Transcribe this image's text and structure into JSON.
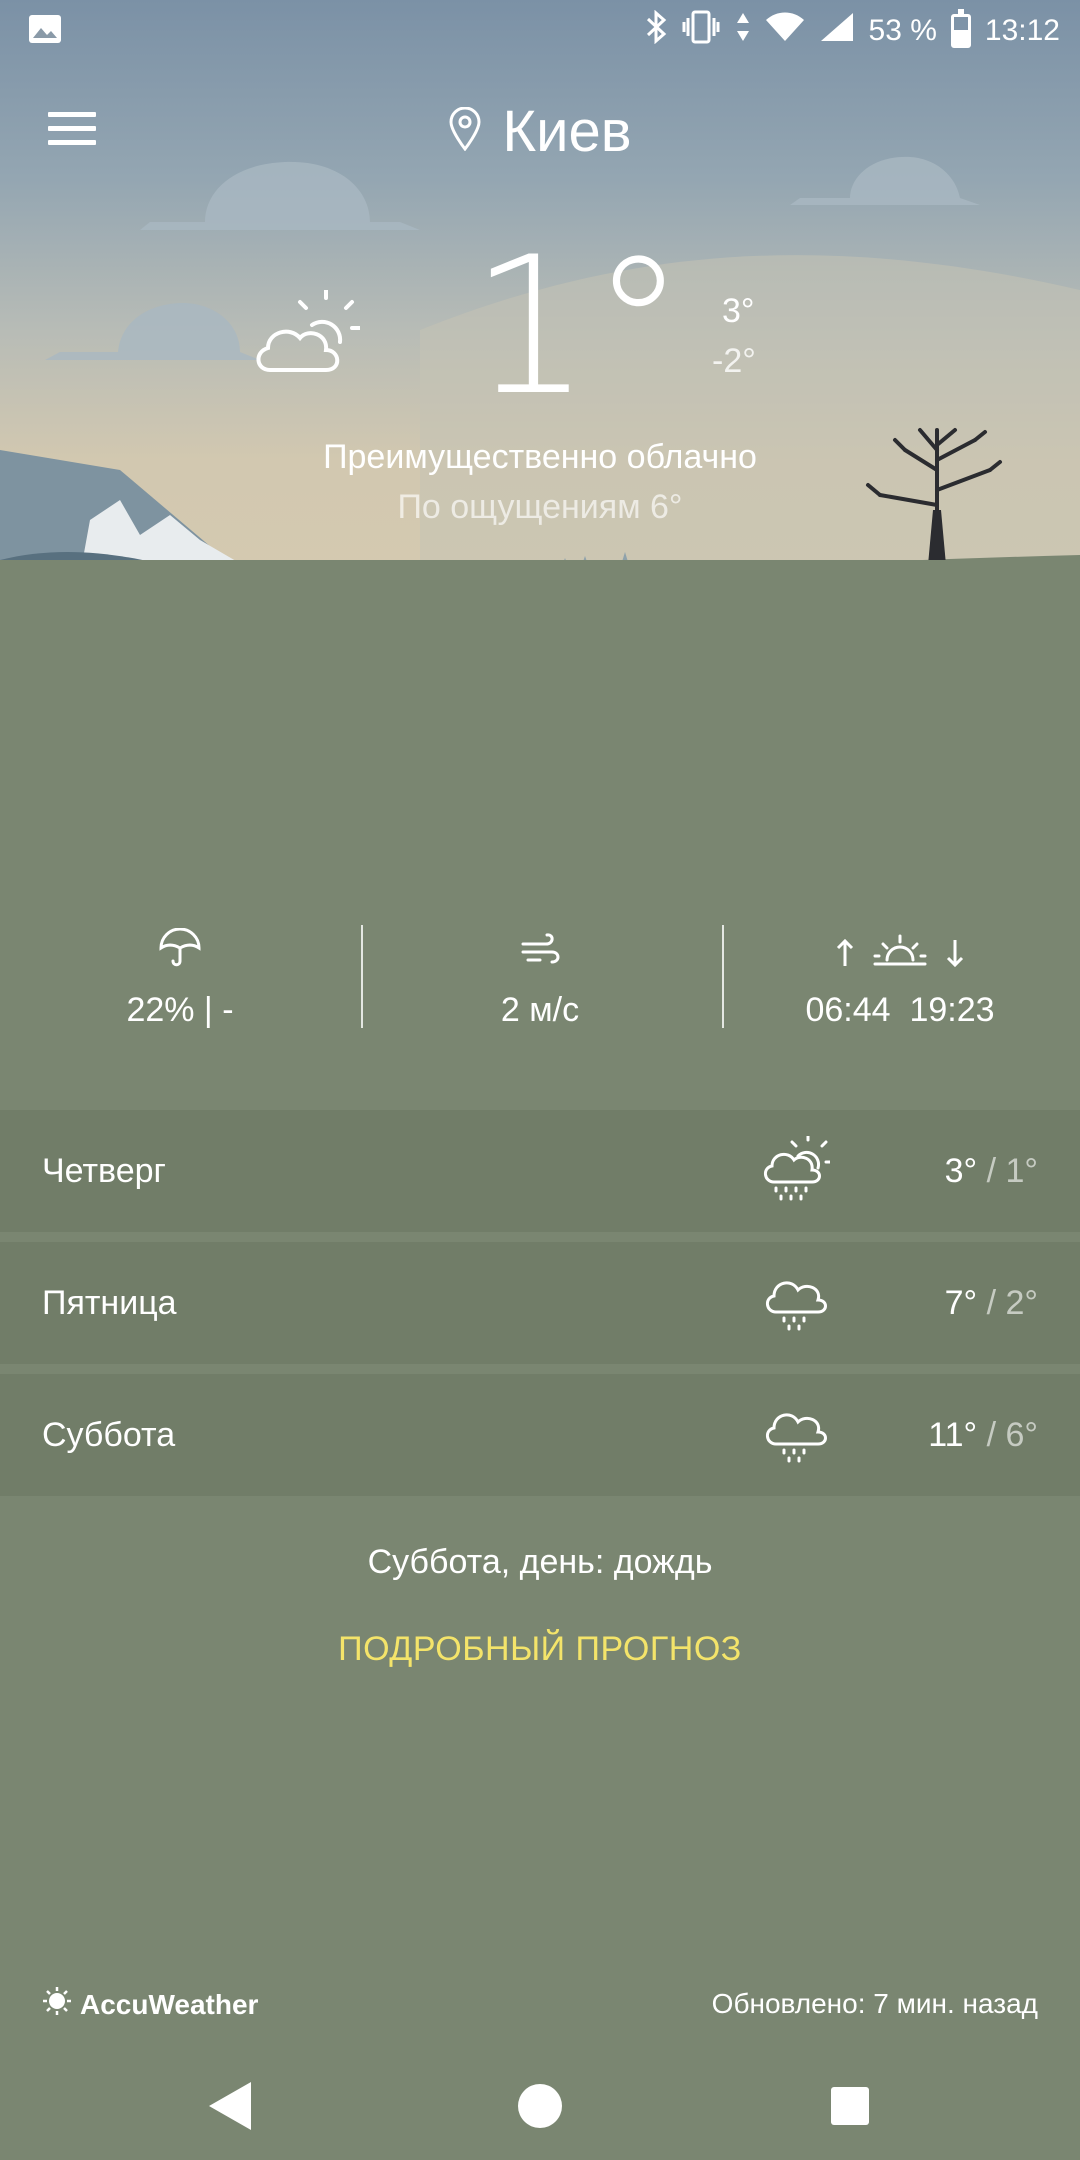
{
  "status_bar": {
    "battery": "53 %",
    "time": "13:12",
    "icons": [
      "image-icon",
      "bluetooth-icon",
      "vibrate-icon",
      "data-arrows-icon",
      "wifi-icon",
      "signal-icon",
      "battery-icon"
    ]
  },
  "header": {
    "city": "Киев",
    "menu_icon": "hamburger-menu-icon",
    "location_icon": "location-pin-icon"
  },
  "current": {
    "temperature": "1°",
    "high": "3°",
    "low": "-2°",
    "condition": "Преимущественно облачно",
    "feels_like": "По ощущениям 6°",
    "icon": "partly-cloudy-icon"
  },
  "stats": {
    "precipitation": "22% | -",
    "wind": "2 м/с",
    "sunrise": "06:44",
    "sunset": "19:23",
    "icons": [
      "umbrella-icon",
      "wind-icon",
      "sunrise-sunset-icon"
    ]
  },
  "forecast": [
    {
      "day": "Четверг",
      "high": "3°",
      "low": "/ 1°",
      "icon": "cloud-sun-rain-icon"
    },
    {
      "day": "Пятница",
      "high": "7°",
      "low": "/ 2°",
      "icon": "cloud-rain-icon"
    },
    {
      "day": "Суббота",
      "high": "11°",
      "low": "/ 6°",
      "icon": "cloud-rain-icon"
    }
  ],
  "summary": "Суббота, день: дождь",
  "more_link": "ПОДРОБНЫЙ ПРОГНОЗ",
  "footer": {
    "brand": "AccuWeather",
    "updated": "Обновлено: 7 мин. назад"
  },
  "colors": {
    "ground": "#7a8671",
    "row": "#717d68",
    "link": "#f4e46a"
  }
}
